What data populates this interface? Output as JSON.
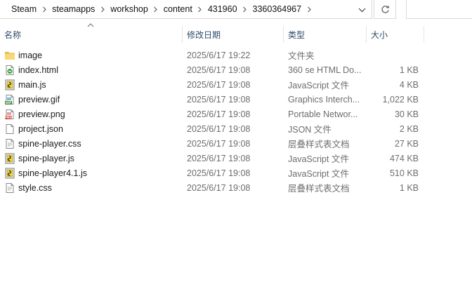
{
  "address_bar": {
    "crumbs": [
      "Steam",
      "steamapps",
      "workshop",
      "content",
      "431960",
      "3360364967"
    ]
  },
  "columns": {
    "name": "名称",
    "date": "修改日期",
    "type": "类型",
    "size": "大小"
  },
  "files": [
    {
      "name": "image",
      "date": "2025/6/17 19:22",
      "type": "文件夹",
      "size": "",
      "icon": "folder-icon"
    },
    {
      "name": "index.html",
      "date": "2025/6/17 19:08",
      "type": "360 se HTML Do...",
      "size": "1 KB",
      "icon": "html-file-icon"
    },
    {
      "name": "main.js",
      "date": "2025/6/17 19:08",
      "type": "JavaScript 文件",
      "size": "4 KB",
      "icon": "js-file-icon"
    },
    {
      "name": "preview.gif",
      "date": "2025/6/17 19:08",
      "type": "Graphics Interch...",
      "size": "1,022 KB",
      "icon": "gif-file-icon"
    },
    {
      "name": "preview.png",
      "date": "2025/6/17 19:08",
      "type": "Portable Networ...",
      "size": "30 KB",
      "icon": "png-file-icon"
    },
    {
      "name": "project.json",
      "date": "2025/6/17 19:08",
      "type": "JSON 文件",
      "size": "2 KB",
      "icon": "json-file-icon"
    },
    {
      "name": "spine-player.css",
      "date": "2025/6/17 19:08",
      "type": "层叠样式表文档",
      "size": "27 KB",
      "icon": "css-file-icon"
    },
    {
      "name": "spine-player.js",
      "date": "2025/6/17 19:08",
      "type": "JavaScript 文件",
      "size": "474 KB",
      "icon": "js-file-icon"
    },
    {
      "name": "spine-player4.1.js",
      "date": "2025/6/17 19:08",
      "type": "JavaScript 文件",
      "size": "510 KB",
      "icon": "js-file-icon"
    },
    {
      "name": "style.css",
      "date": "2025/6/17 19:08",
      "type": "层叠样式表文档",
      "size": "1 KB",
      "icon": "css-file-icon"
    }
  ]
}
